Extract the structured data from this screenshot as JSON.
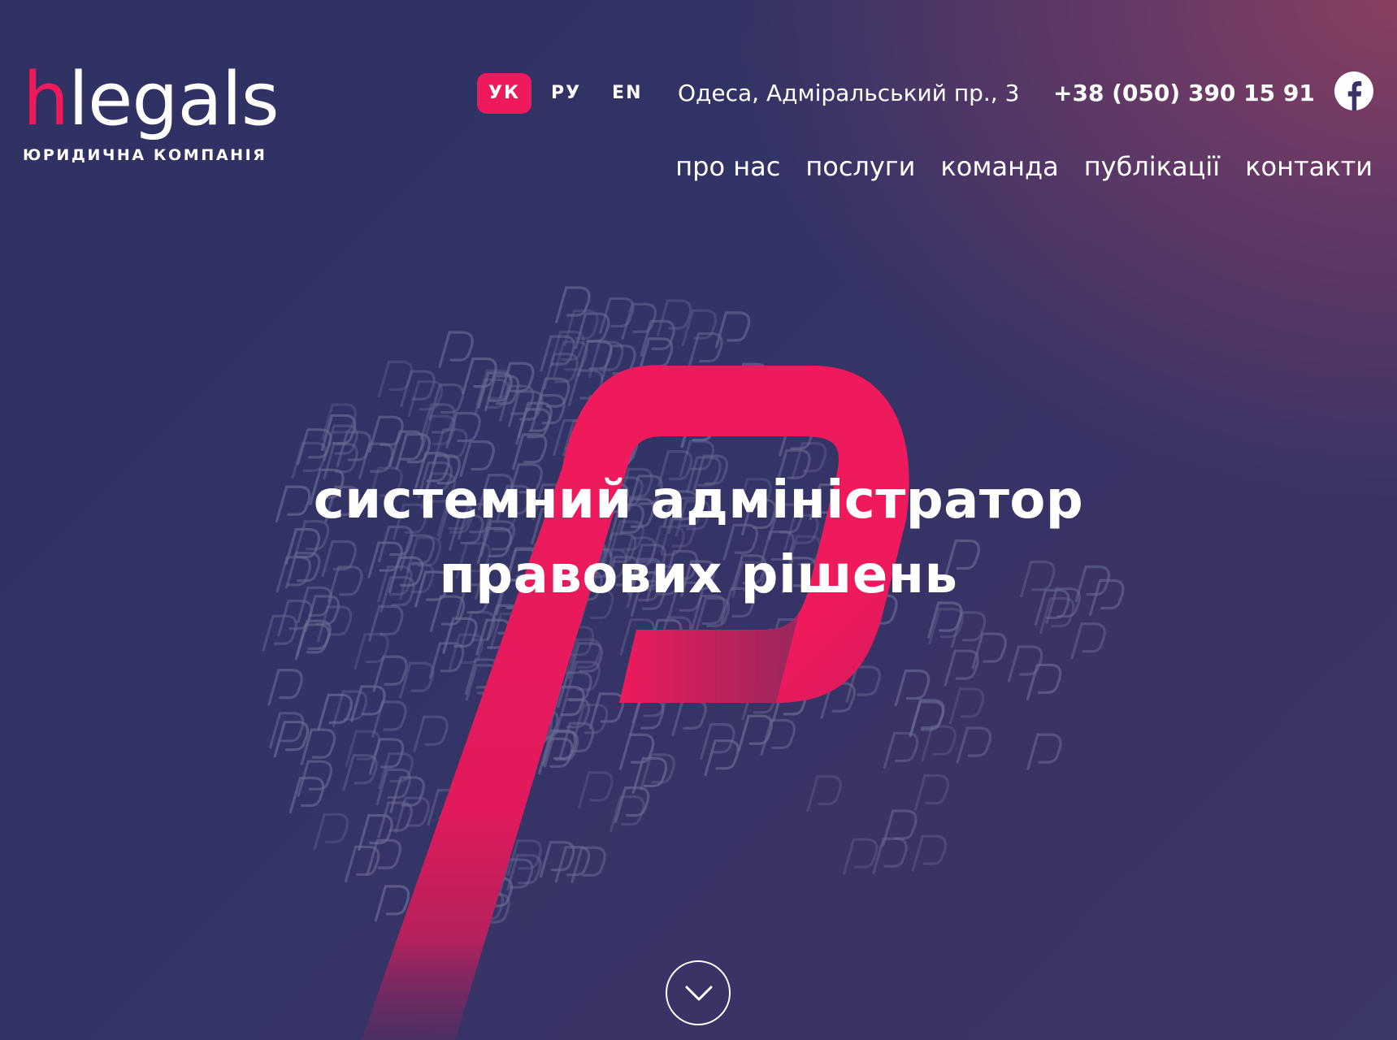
{
  "logo": {
    "letter_accent": "h",
    "word_rest": "legals",
    "subtitle": "ЮРИДИЧНА КОМПАНІЯ",
    "accent_color": "#ee1a5c"
  },
  "header": {
    "languages": [
      {
        "label": "УК",
        "active": true
      },
      {
        "label": "РУ",
        "active": false
      },
      {
        "label": "EN",
        "active": false
      }
    ],
    "address": "Одеса, Адміральський пр., 3",
    "phone": "+38 (050) 390 15 91",
    "social_icon": "facebook-icon"
  },
  "nav": {
    "items": [
      "про нас",
      "послуги",
      "команда",
      "публікації",
      "контакти"
    ]
  },
  "hero": {
    "line1": "системний адміністратор",
    "line2": "правових рішень",
    "scroll_icon": "chevron-down-icon"
  },
  "colors": {
    "accent": "#ee1a5c",
    "background_dark": "#2f3163",
    "background_warm": "#8c4060"
  }
}
